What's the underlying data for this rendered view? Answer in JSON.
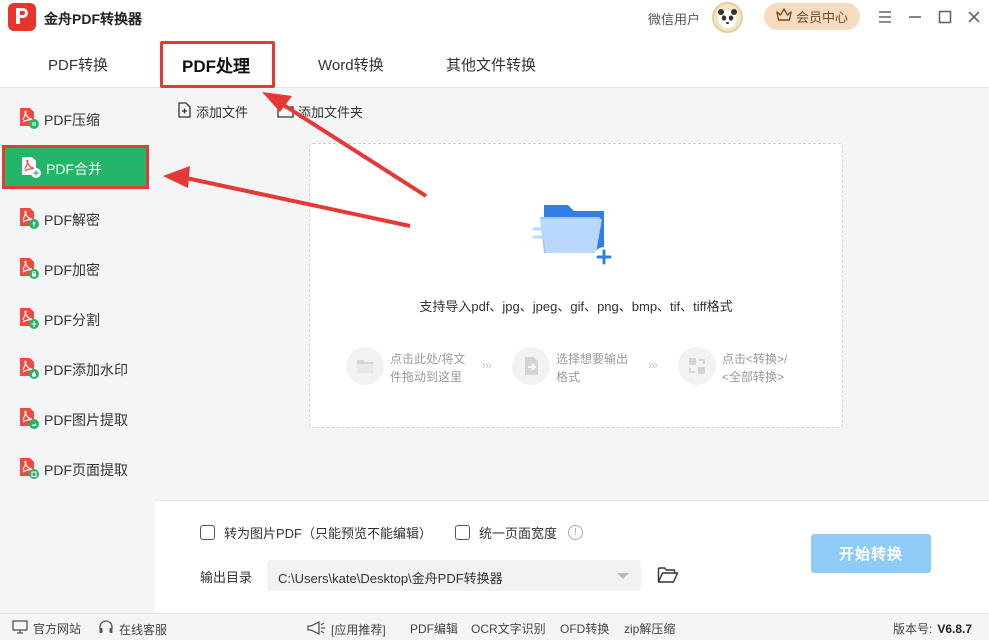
{
  "app": {
    "title": "金舟PDF转换器",
    "user_label": "微信用户",
    "vip_label": "会员中心"
  },
  "tabs": [
    {
      "label": "PDF转换",
      "active": false
    },
    {
      "label": "PDF处理",
      "active": true
    },
    {
      "label": "Word转换",
      "active": false
    },
    {
      "label": "其他文件转换",
      "active": false
    }
  ],
  "sidebar": {
    "items": [
      {
        "label": "PDF压缩",
        "icon": "pdf-compress-icon",
        "active": false
      },
      {
        "label": "PDF合并",
        "icon": "pdf-merge-icon",
        "active": true
      },
      {
        "label": "PDF解密",
        "icon": "pdf-decrypt-icon",
        "active": false
      },
      {
        "label": "PDF加密",
        "icon": "pdf-encrypt-icon",
        "active": false
      },
      {
        "label": "PDF分割",
        "icon": "pdf-split-icon",
        "active": false
      },
      {
        "label": "PDF添加水印",
        "icon": "pdf-watermark-icon",
        "active": false
      },
      {
        "label": "PDF图片提取",
        "icon": "pdf-image-extract-icon",
        "active": false
      },
      {
        "label": "PDF页面提取",
        "icon": "pdf-page-extract-icon",
        "active": false
      }
    ]
  },
  "toolbar": {
    "add_file": "添加文件",
    "add_folder": "添加文件夹"
  },
  "dropzone": {
    "formats_text": "支持导入pdf、jpg、jpeg、gif、png、bmp、tif、tiff格式",
    "steps": [
      {
        "line1": "点击此处/将文",
        "line2": "件拖动到这里"
      },
      {
        "line1": "选择想要输出",
        "line2": "格式"
      },
      {
        "line1": "点击<转换>/",
        "line2": "<全部转换>"
      }
    ],
    "step_arrows": "›››"
  },
  "options": {
    "to_image_pdf": "转为图片PDF（只能预览不能编辑）",
    "uniform_width": "统一页面宽度",
    "info_glyph": "!",
    "output_label": "输出目录",
    "output_path": "C:\\Users\\kate\\Desktop\\金舟PDF转换器",
    "start_button": "开始转换"
  },
  "statusbar": {
    "website": "官方网站",
    "support": "在线客服",
    "recommend": "[应用推荐]",
    "links": [
      "PDF编辑",
      "OCR文字识别",
      "OFD转换",
      "zip解压缩"
    ],
    "version_label": "版本号:",
    "version": "V6.8.7"
  },
  "colors": {
    "accent_green": "#24b569",
    "highlight_red": "#e53935",
    "start_button": "#8ecbf7",
    "brand_red": "#e8342a"
  }
}
